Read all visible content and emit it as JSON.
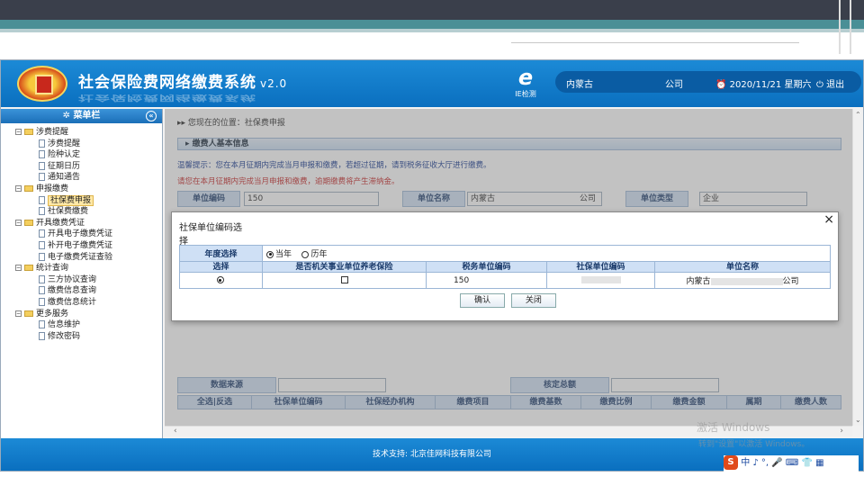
{
  "app": {
    "title": "社会保险费网络缴费系统",
    "version": "v2.0",
    "ie_badge": "IE检测",
    "org_prefix": "内蒙古",
    "org_suffix": "公司",
    "datetime": "2020/11/21 星期六",
    "logout": "退出",
    "footer": "技术支持: 北京佳网科技有限公司"
  },
  "sidebar": {
    "header": "菜单栏",
    "groups": [
      {
        "label": "涉费提醒",
        "items": [
          "涉费提醒",
          "险种认定",
          "征期日历",
          "通知通告"
        ]
      },
      {
        "label": "申报缴费",
        "items": [
          "社保费申报",
          "社保费缴费"
        ]
      },
      {
        "label": "开具缴费凭证",
        "items": [
          "开具电子缴费凭证",
          "补开电子缴费凭证",
          "电子缴费凭证查验"
        ]
      },
      {
        "label": "统计查询",
        "items": [
          "三方协议查询",
          "缴费信息查询",
          "缴费信息统计"
        ]
      },
      {
        "label": "更多服务",
        "items": [
          "信息维护",
          "修改密码"
        ]
      }
    ],
    "active_item": "社保费申报"
  },
  "main": {
    "breadcrumb": "您现在的位置：社保费申报",
    "section_title": "缴费人基本信息",
    "tip1": "温馨提示：您在本月征期内完成当月申报和缴费，若超过征期，请到税务征收大厅进行缴费。",
    "tip2": "请您在本月征期内完成当月申报和缴费，逾期缴费将产生滞纳金。",
    "fields": {
      "unit_code_label": "单位编码",
      "unit_code_value": "150",
      "unit_name_label": "单位名称",
      "unit_name_value": "内蒙古",
      "unit_name_suffix": "公司",
      "unit_type_label": "单位类型",
      "unit_type_value": "企业"
    },
    "lower": {
      "data_source_label": "数据来源",
      "total_label": "核定总额",
      "columns": [
        "全选|反选",
        "社保单位编码",
        "社保经办机构",
        "缴费项目",
        "缴费基数",
        "缴费比例",
        "缴费金额",
        "属期",
        "缴费人数"
      ]
    }
  },
  "modal": {
    "title": "社保单位编码选择",
    "close": "×",
    "year_label": "年度选择",
    "year_options": [
      "当年",
      "历年"
    ],
    "year_selected": "当年",
    "columns": [
      "选择",
      "是否机关事业单位养老保险",
      "税务单位编码",
      "社保单位编码",
      "单位名称"
    ],
    "rows": [
      {
        "selected": true,
        "is_institution": false,
        "tax_code": "150",
        "sb_code": "",
        "unit_name_prefix": "内蒙古",
        "unit_name_suffix": "公司"
      }
    ],
    "confirm": "确认",
    "close_btn": "关闭"
  },
  "os": {
    "watermark1": "激活 Windows",
    "watermark2": "转到\"设置\"以激活 Windows。",
    "ime": "中 ♪ °, 🎤 ⌨ 👕 ▦"
  }
}
